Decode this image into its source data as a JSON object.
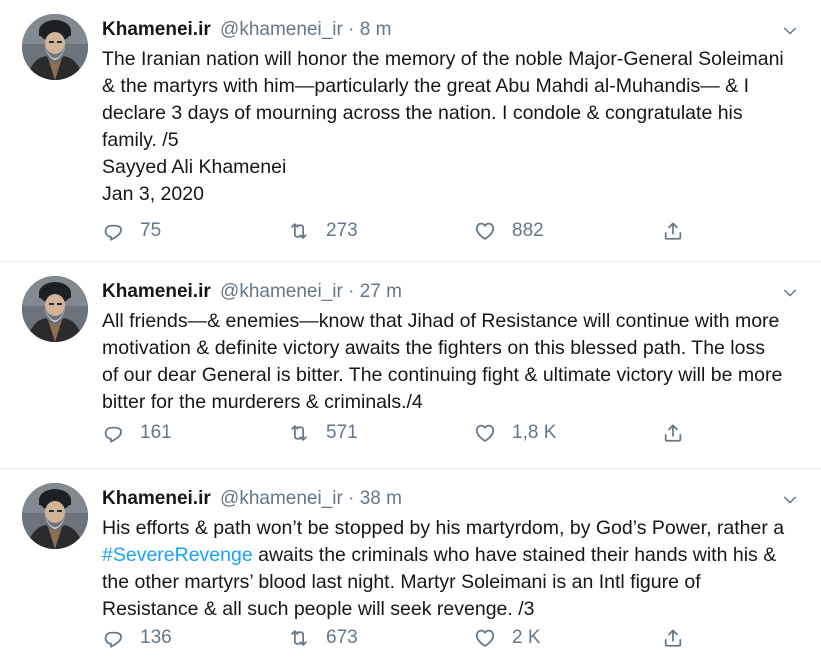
{
  "tweets": [
    {
      "name": "Khamenei.ir",
      "handle": "@khamenei_ir",
      "dot": "·",
      "time": "8 m",
      "lines": [
        "The Iranian nation will honor the memory of the noble Major-General Soleimani & the martyrs with him—particularly the great Abu Mahdi al-Muhandis— & I declare 3 days of mourning across the nation. I condole & congratulate his family. /5",
        "Sayyed Ali Khamenei",
        "Jan 3, 2020"
      ],
      "replies": "75",
      "retweets": "273",
      "likes": "882"
    },
    {
      "name": "Khamenei.ir",
      "handle": "@khamenei_ir",
      "dot": "·",
      "time": "27 m",
      "text": "All friends—& enemies—know that Jihad of Resistance will continue with more motivation & definite victory awaits the fighters on this blessed path. The loss of our dear General is bitter. The continuing fight & ultimate victory will be more bitter for the murderers & criminals./4",
      "replies": "161",
      "retweets": "571",
      "likes": "1,8 K"
    },
    {
      "name": "Khamenei.ir",
      "handle": "@khamenei_ir",
      "dot": "·",
      "time": "38 m",
      "text_before": "His efforts & path won’t be stopped by his martyrdom, by God’s Power, rather a ",
      "hashtag": "#SevereRevenge",
      "text_after": " awaits the criminals who have stained their hands with his & the other martyrs’ blood last night. Martyr Soleimani is an Intl figure of Resistance & all such people will seek revenge. /3",
      "replies": "136",
      "retweets": "673",
      "likes": "2 K"
    }
  ],
  "icons": {
    "reply": "reply-icon",
    "retweet": "retweet-icon",
    "like": "heart-icon",
    "share": "share-icon",
    "caret": "chevron-down-icon",
    "avatar": "avatar"
  },
  "colors": {
    "text": "#14171a",
    "secondary": "#657786",
    "link": "#1da1f2",
    "divider": "#e6ecf0"
  }
}
